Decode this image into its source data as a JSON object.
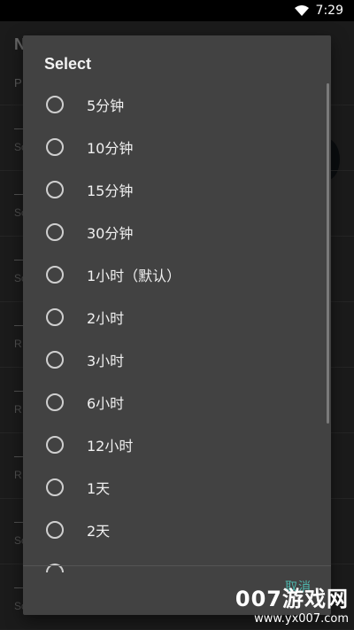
{
  "statusbar": {
    "time": "7:29"
  },
  "background": {
    "title": "N",
    "subtitle": "P",
    "rows": [
      {
        "l1": "—",
        "l2": "Sc"
      },
      {
        "l1": "—",
        "l2": "Sc"
      },
      {
        "l1": "—",
        "l2": "Sc"
      },
      {
        "l1": "—",
        "l2": "R"
      },
      {
        "l1": "—",
        "l2": "R"
      },
      {
        "l1": "—",
        "l2": "R"
      },
      {
        "l1": "—",
        "l2": "Sc"
      },
      {
        "l1": "—",
        "l2": "Sc"
      }
    ]
  },
  "dialog": {
    "title": "Select",
    "options": [
      {
        "label": "5分钟"
      },
      {
        "label": "10分钟"
      },
      {
        "label": "15分钟"
      },
      {
        "label": "30分钟"
      },
      {
        "label": "1小时（默认）"
      },
      {
        "label": "2小时"
      },
      {
        "label": "3小时"
      },
      {
        "label": "6小时"
      },
      {
        "label": "12小时"
      },
      {
        "label": "1天"
      },
      {
        "label": "2天"
      }
    ],
    "cancel_label": "取消"
  },
  "watermark": {
    "top": "007游戏网",
    "bottom": "www.yx007.com"
  }
}
